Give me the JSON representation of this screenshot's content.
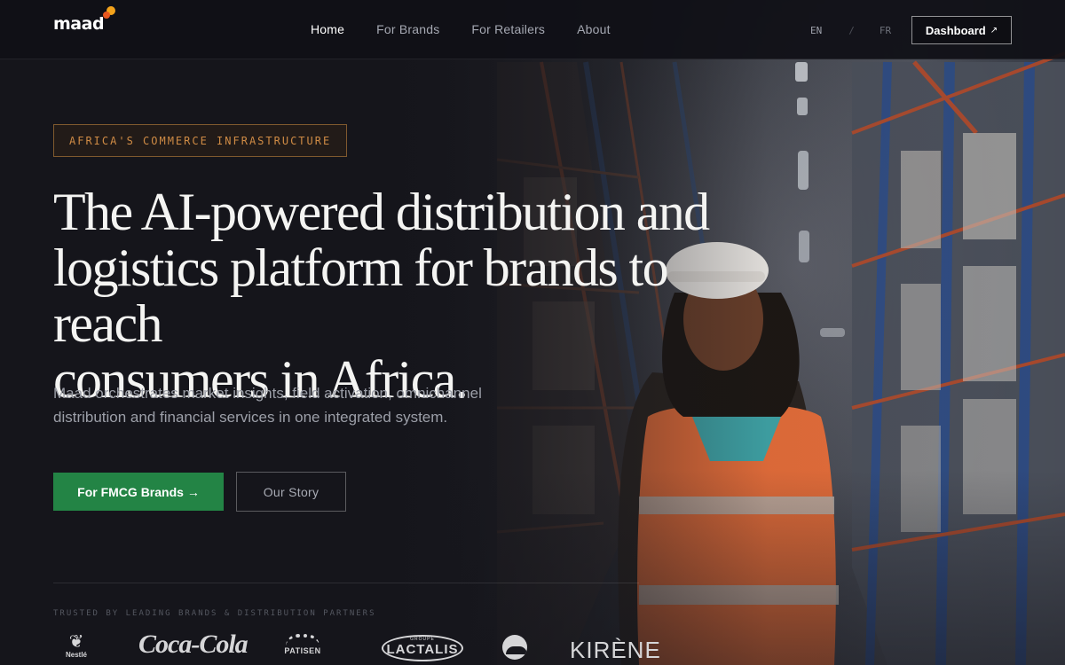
{
  "brand": {
    "logo_text": "maad"
  },
  "nav": {
    "items": [
      {
        "label": "Home",
        "active": true
      },
      {
        "label": "For Brands",
        "active": false
      },
      {
        "label": "For Retailers",
        "active": false
      },
      {
        "label": "About",
        "active": false
      }
    ]
  },
  "lang": {
    "en": "EN",
    "separator": "/",
    "fr": "FR",
    "active": "EN"
  },
  "dashboard_button": {
    "label": "Dashboard",
    "arrow": "↗"
  },
  "hero": {
    "badge": "AFRICA'S COMMERCE INFRASTRUCTURE",
    "headline_lines": [
      "The AI-powered distribution and",
      "logistics platform for brands to reach",
      "consumers in Africa."
    ],
    "subtext": "Maad orchestrates market insights, field activation, omnichannel distribution and financial services in one integrated system.",
    "primary_cta": "For FMCG Brands →",
    "secondary_cta": "Our Story"
  },
  "partners": {
    "label": "TRUSTED BY LEADING BRANDS & DISTRIBUTION PARTNERS",
    "logos": [
      {
        "name": "Nestlé",
        "icon": "nestle-logo"
      },
      {
        "name": "Coca-Cola",
        "icon": "coca-cola-logo"
      },
      {
        "name": "PATISEN",
        "icon": "patisen-logo"
      },
      {
        "name": "LACTALIS",
        "group": "GROUPE",
        "icon": "lactalis-logo"
      },
      {
        "name": "",
        "icon": "wave-logo"
      },
      {
        "name": "KIRÈNE",
        "icon": "kirene-logo"
      }
    ]
  },
  "colors": {
    "background": "#15151b",
    "primary_green": "#238445",
    "badge_orange": "#cf8b45",
    "logo_orange": "#f3a21b",
    "logo_red": "#e7571f"
  }
}
